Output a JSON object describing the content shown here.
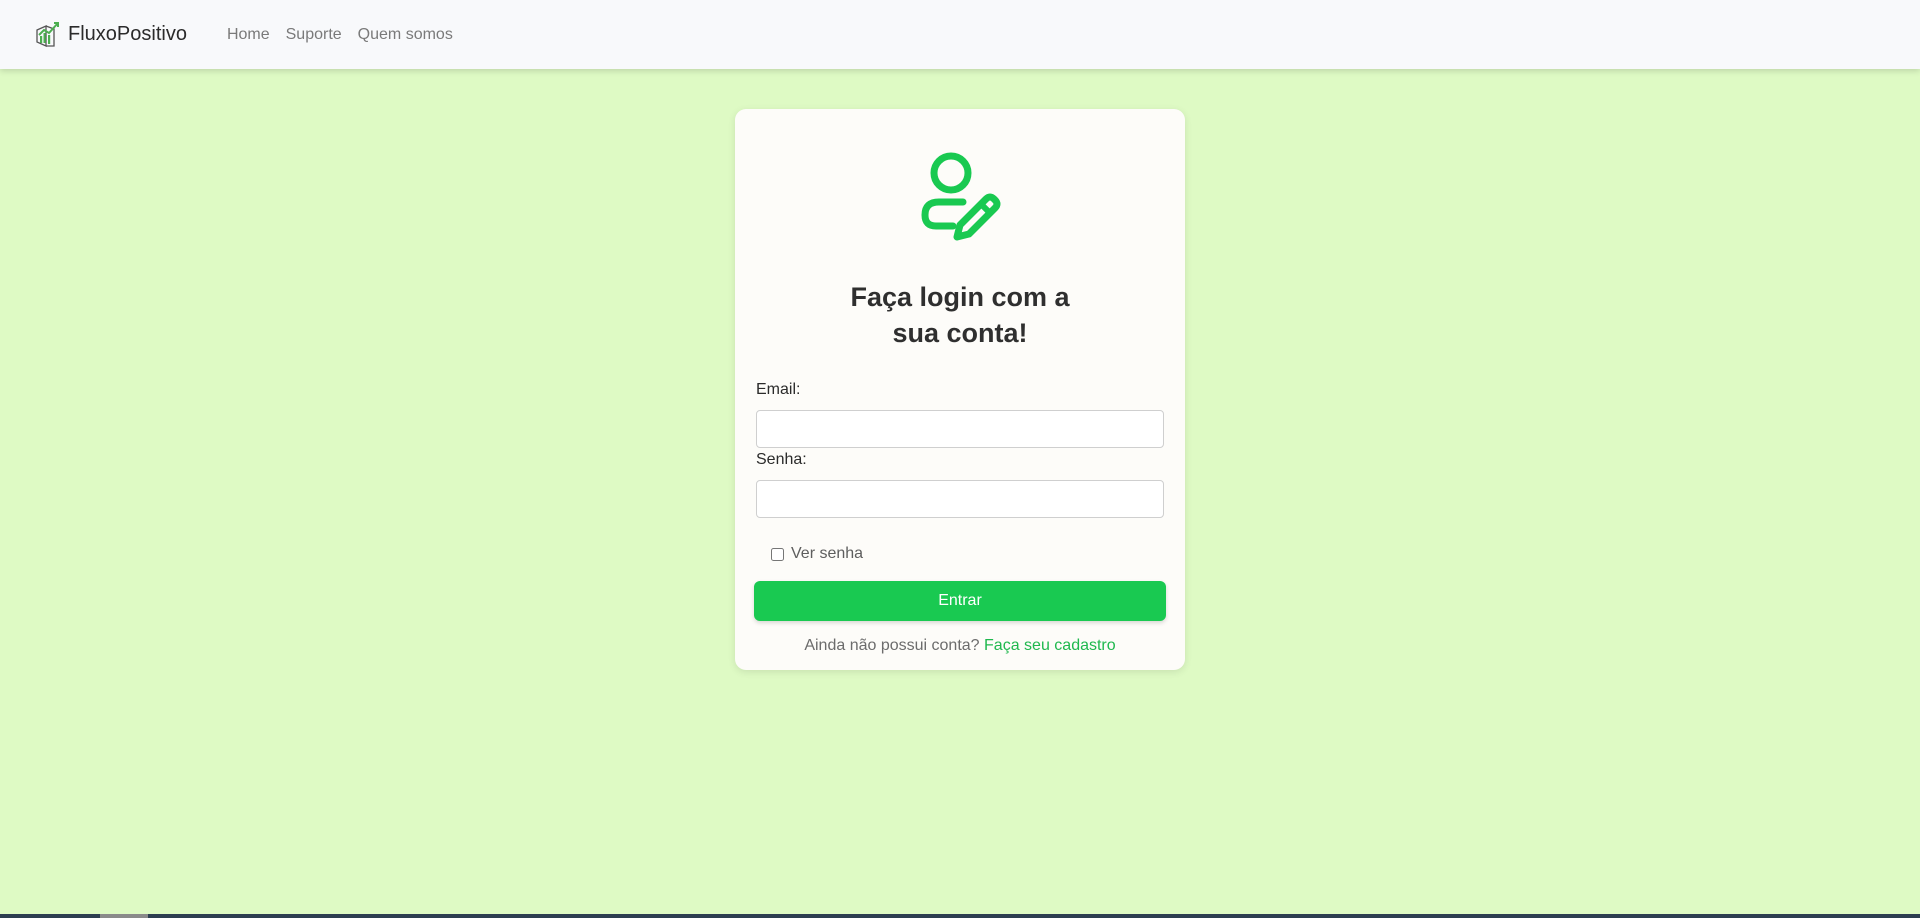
{
  "navbar": {
    "brand": "FluxoPositivo",
    "links": [
      "Home",
      "Suporte",
      "Quem somos"
    ]
  },
  "login": {
    "title": "Faça login com a sua conta!",
    "email_label": "Email:",
    "email_value": "",
    "password_label": "Senha:",
    "password_value": "",
    "show_password_label": "Ver senha",
    "show_password_checked": false,
    "submit_label": "Entrar",
    "signup_prompt": "Ainda não possui conta?",
    "signup_link": "Faça seu cadastro"
  },
  "icons": {
    "brand": "chart-logo-icon",
    "header": "user-edit-icon"
  },
  "colors": {
    "background": "#defac4",
    "accent": "#19c951",
    "link": "#1fb84e",
    "navbar": "#f8f9fb"
  }
}
